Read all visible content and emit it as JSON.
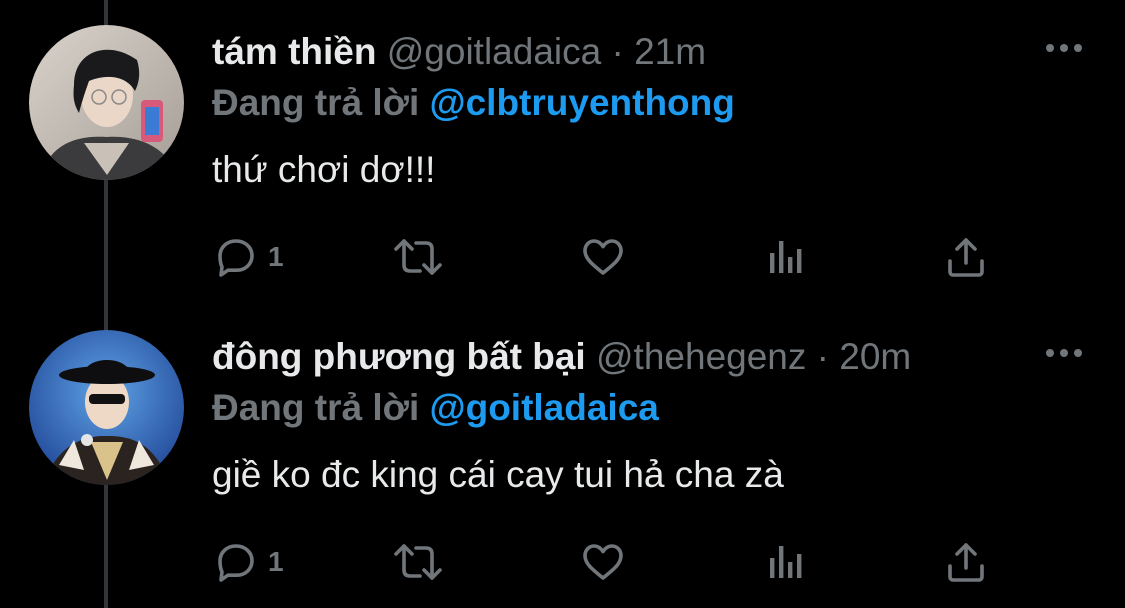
{
  "tweets": [
    {
      "name": "tám thiền",
      "handle": "@goitladaica",
      "separator": "·",
      "time": "21m",
      "reply_prefix": "Đang trả lời",
      "reply_to": "@clbtruyenthong",
      "text": "thứ chơi dơ!!!",
      "reply_count": "1",
      "avatar_icon": "profile-photo"
    },
    {
      "name": "đông phương bất bại",
      "handle": "@thehegenz",
      "separator": "·",
      "time": "20m",
      "reply_prefix": "Đang trả lời",
      "reply_to": "@goitladaica",
      "text": "giề ko đc king cái cay tui hả cha zà",
      "reply_count": "1",
      "avatar_icon": "profile-photo"
    }
  ],
  "icons": {
    "reply": "speech-bubble-icon",
    "retweet": "retweet-icon",
    "like": "heart-icon",
    "views": "bar-chart-icon",
    "share": "share-upload-icon",
    "more": "ellipsis-icon"
  },
  "colors": {
    "background": "#000000",
    "text": "#e7e9ea",
    "muted": "#71767b",
    "link": "#1d9bf0",
    "thread_line": "#333639"
  }
}
